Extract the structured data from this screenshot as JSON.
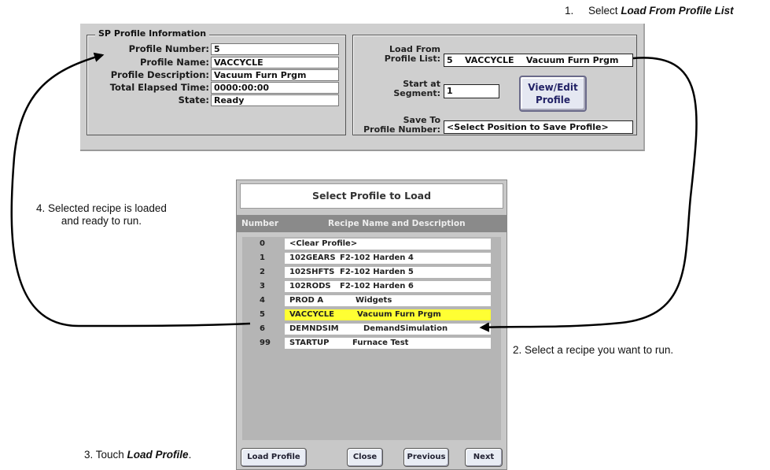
{
  "annotations": {
    "step1_prefix": "1.",
    "step1_text": "Select ",
    "step1_bold": "Load From Profile List",
    "step2": "2. Select a recipe you  want to run.",
    "step3_text": "3. Touch ",
    "step3_bold": "Load Profile",
    "step3_suffix": ".",
    "step4_line1": "4. Selected recipe is loaded",
    "step4_line2": "and ready to run."
  },
  "profile_info": {
    "group_title": "SP Profile Information",
    "number_label": "Profile Number:",
    "number_value": "5",
    "name_label": "Profile Name:",
    "name_value": "VACCYCLE",
    "description_label": "Profile Description:",
    "description_value": "Vacuum Furn Prgm",
    "elapsed_label": "Total Elapsed Time:",
    "elapsed_value": "0000:00:00",
    "state_label": "State:",
    "state_value": "Ready"
  },
  "load_panel": {
    "load_from_label_1": "Load From",
    "load_from_label_2": "Profile List:",
    "load_from_value": "5    VACCYCLE    Vacuum Furn Prgm",
    "start_label_1": "Start at",
    "start_label_2": "Segment:",
    "start_value": "1",
    "view_edit_button_1": "View/Edit",
    "view_edit_button_2": "Profile",
    "save_label_1": "Save To",
    "save_label_2": "Profile Number:",
    "save_value": "<Select Position to Save Profile>"
  },
  "dialog": {
    "title": "Select Profile to Load",
    "col_number": "Number",
    "col_recipe": "Recipe Name and Description",
    "rows": [
      {
        "number": "0",
        "name": "<Clear Profile>",
        "desc": ""
      },
      {
        "number": "1",
        "name": "102GEARS",
        "desc": "F2-102 Harden 4"
      },
      {
        "number": "2",
        "name": "102SHFTS",
        "desc": "F2-102 Harden 5"
      },
      {
        "number": "3",
        "name": "102RODS",
        "desc": "F2-102 Harden 6"
      },
      {
        "number": "4",
        "name": "PROD A",
        "desc": "Widgets"
      },
      {
        "number": "5",
        "name": "VACCYCLE",
        "desc": "Vacuum Furn Prgm"
      },
      {
        "number": "6",
        "name": "DEMNDSIM",
        "desc": "DemandSimulation"
      },
      {
        "number": "99",
        "name": "STARTUP",
        "desc": "Furnace Test"
      }
    ],
    "selected_number": "5",
    "buttons": {
      "load": "Load Profile",
      "close": "Close",
      "previous": "Previous",
      "next": "Next"
    }
  },
  "colors": {
    "selection": "#ffff33",
    "panel": "#cfcfcf",
    "header": "#8a8a8a"
  }
}
